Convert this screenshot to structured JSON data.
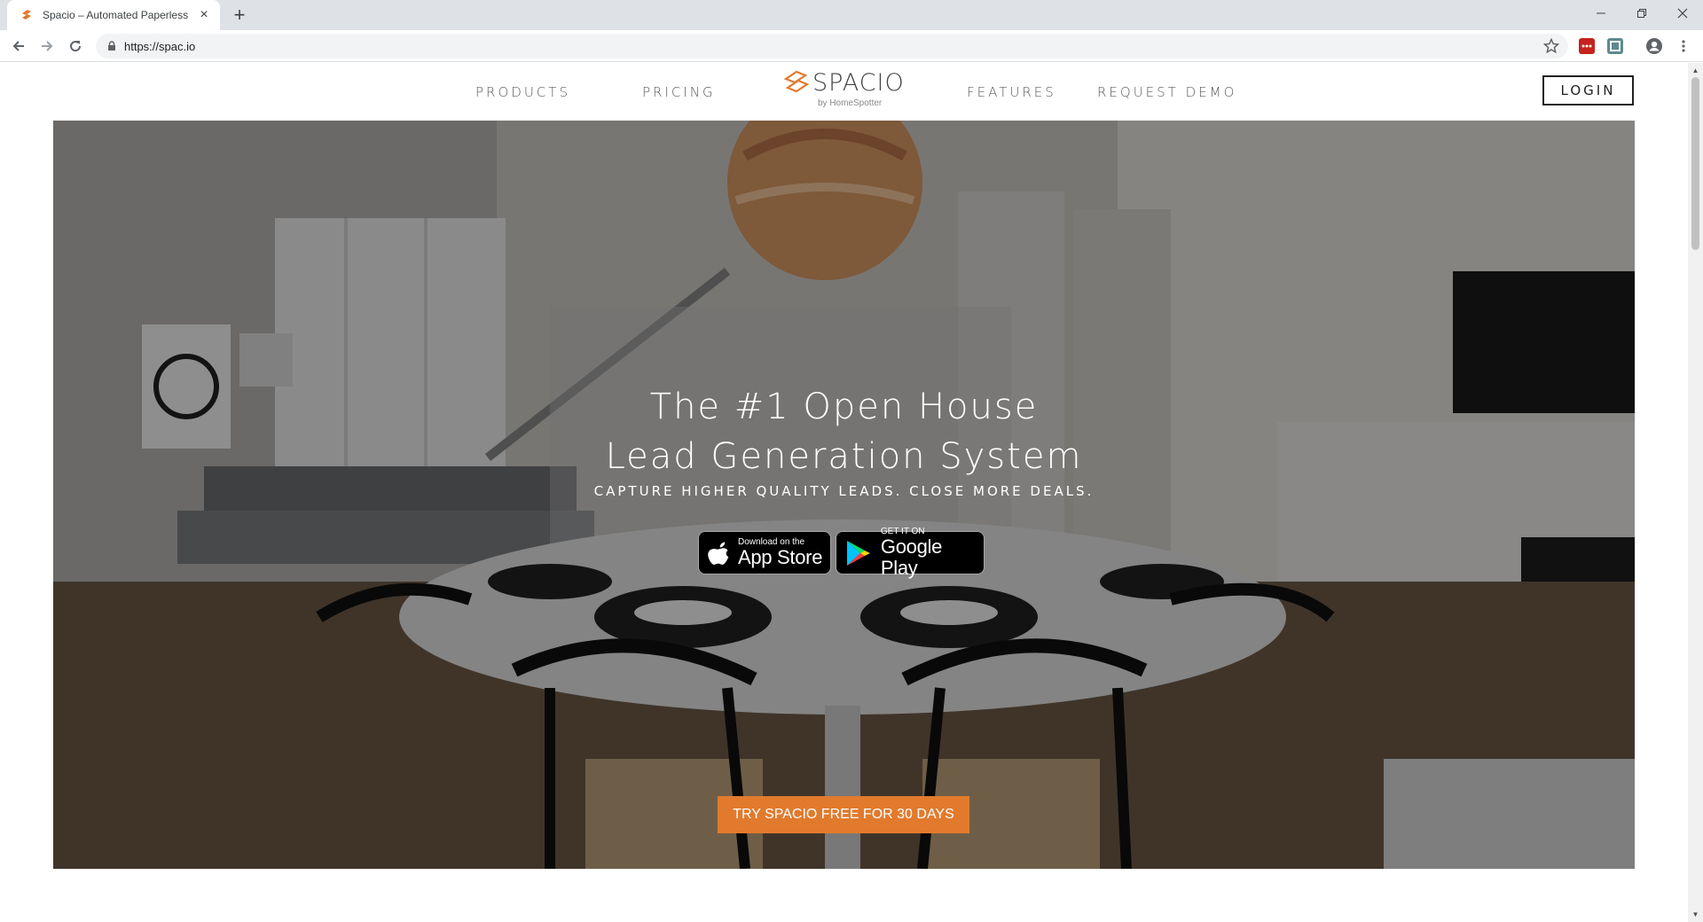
{
  "browser": {
    "tab_title": "Spacio – Automated Paperless O",
    "tab_close": "×",
    "new_tab": "+",
    "url": "https://spac.io",
    "window_minimize": "–",
    "window_restore": "❐",
    "window_close": "✕"
  },
  "nav": {
    "products": "PRODUCTS",
    "pricing": "PRICING",
    "logo_word": "SPACIO",
    "logo_sub": "by HomeSpotter",
    "features": "FEATURES",
    "request_demo": "REQUEST DEMO",
    "login": "LOGIN"
  },
  "hero": {
    "headline_line1": "The #1 Open House",
    "headline_line2": "Lead Generation System",
    "subline": "CAPTURE HIGHER QUALITY LEADS. CLOSE MORE DEALS.",
    "app_store_small": "Download on the",
    "app_store_big": "App Store",
    "google_play_small": "GET IT ON",
    "google_play_big": "Google Play",
    "cta": "TRY SPACIO FREE FOR 30 DAYS"
  },
  "colors": {
    "brand_orange": "#e27a2d",
    "tabbar_bg": "#dee1e6",
    "nav_text": "#5b5b5b"
  },
  "icons": [
    "spacio-favicon",
    "back-arrow-icon",
    "forward-arrow-icon",
    "reload-icon",
    "lock-icon",
    "star-icon",
    "profile-icon",
    "menu-dots-icon",
    "apple-icon",
    "google-play-icon"
  ]
}
